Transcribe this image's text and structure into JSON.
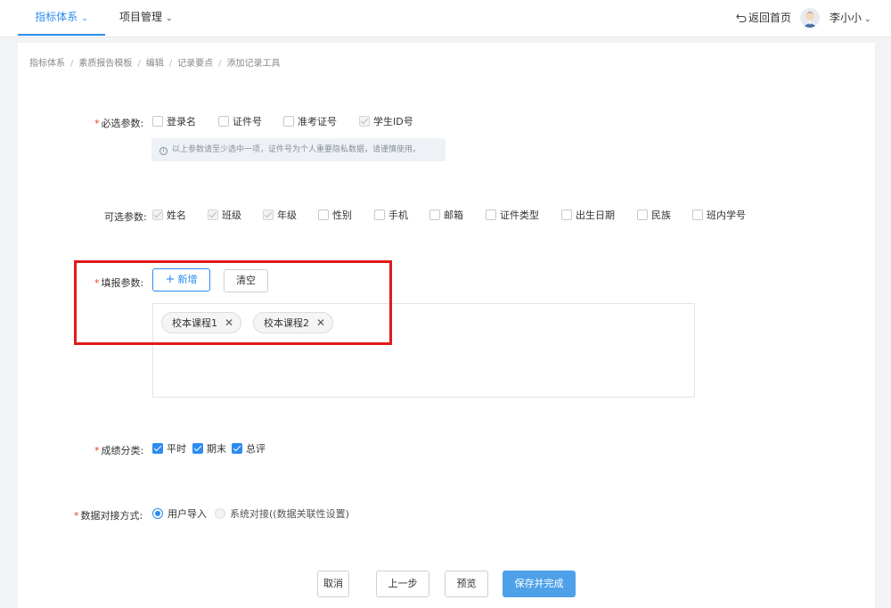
{
  "nav": {
    "tabs": [
      {
        "label": "指标体系"
      },
      {
        "label": "项目管理"
      }
    ],
    "back_home": "返回首页",
    "user_name": "李小小"
  },
  "breadcrumb": [
    "指标体系",
    "素质报告模板",
    "编辑",
    "记录要点",
    "添加记录工具"
  ],
  "required_params": {
    "label": "必选参数:",
    "options": [
      {
        "label": "登录名",
        "state": "unchecked"
      },
      {
        "label": "证件号",
        "state": "unchecked"
      },
      {
        "label": "准考证号",
        "state": "unchecked"
      },
      {
        "label": "学生ID号",
        "state": "disabled-checked"
      }
    ],
    "notice": "以上参数请至少选中一项，证件号为个人重要隐私数据，请谨慎使用。"
  },
  "optional_params": {
    "label": "可选参数:",
    "options": [
      {
        "label": "姓名",
        "state": "disabled-checked"
      },
      {
        "label": "班级",
        "state": "disabled-checked"
      },
      {
        "label": "年级",
        "state": "disabled-checked"
      },
      {
        "label": "性别",
        "state": "unchecked"
      },
      {
        "label": "手机",
        "state": "unchecked"
      },
      {
        "label": "邮箱",
        "state": "unchecked"
      },
      {
        "label": "证件类型",
        "state": "unchecked"
      },
      {
        "label": "出生日期",
        "state": "unchecked"
      },
      {
        "label": "民族",
        "state": "unchecked"
      },
      {
        "label": "班内学号",
        "state": "unchecked"
      }
    ]
  },
  "fill_params": {
    "label": "填报参数:",
    "add_button": "新增",
    "clear_button": "清空",
    "tags": [
      "校本课程1",
      "校本课程2"
    ]
  },
  "score_category": {
    "label": "成绩分类:",
    "options": [
      {
        "label": "平时",
        "state": "checked"
      },
      {
        "label": "期末",
        "state": "checked"
      },
      {
        "label": "总评",
        "state": "checked"
      }
    ]
  },
  "data_mode": {
    "label": "数据对接方式:",
    "options": [
      {
        "label": "用户导入",
        "selected": true
      },
      {
        "label": "系统对接((数据关联性设置)",
        "selected": false
      }
    ]
  },
  "footer": {
    "cancel": "取消",
    "prev": "上一步",
    "preview": "预览",
    "save": "保存并完成"
  },
  "colors": {
    "accent": "#2d8cf0",
    "highlight_frame": "#e21a1a",
    "save_button": "#4ea1e8"
  }
}
